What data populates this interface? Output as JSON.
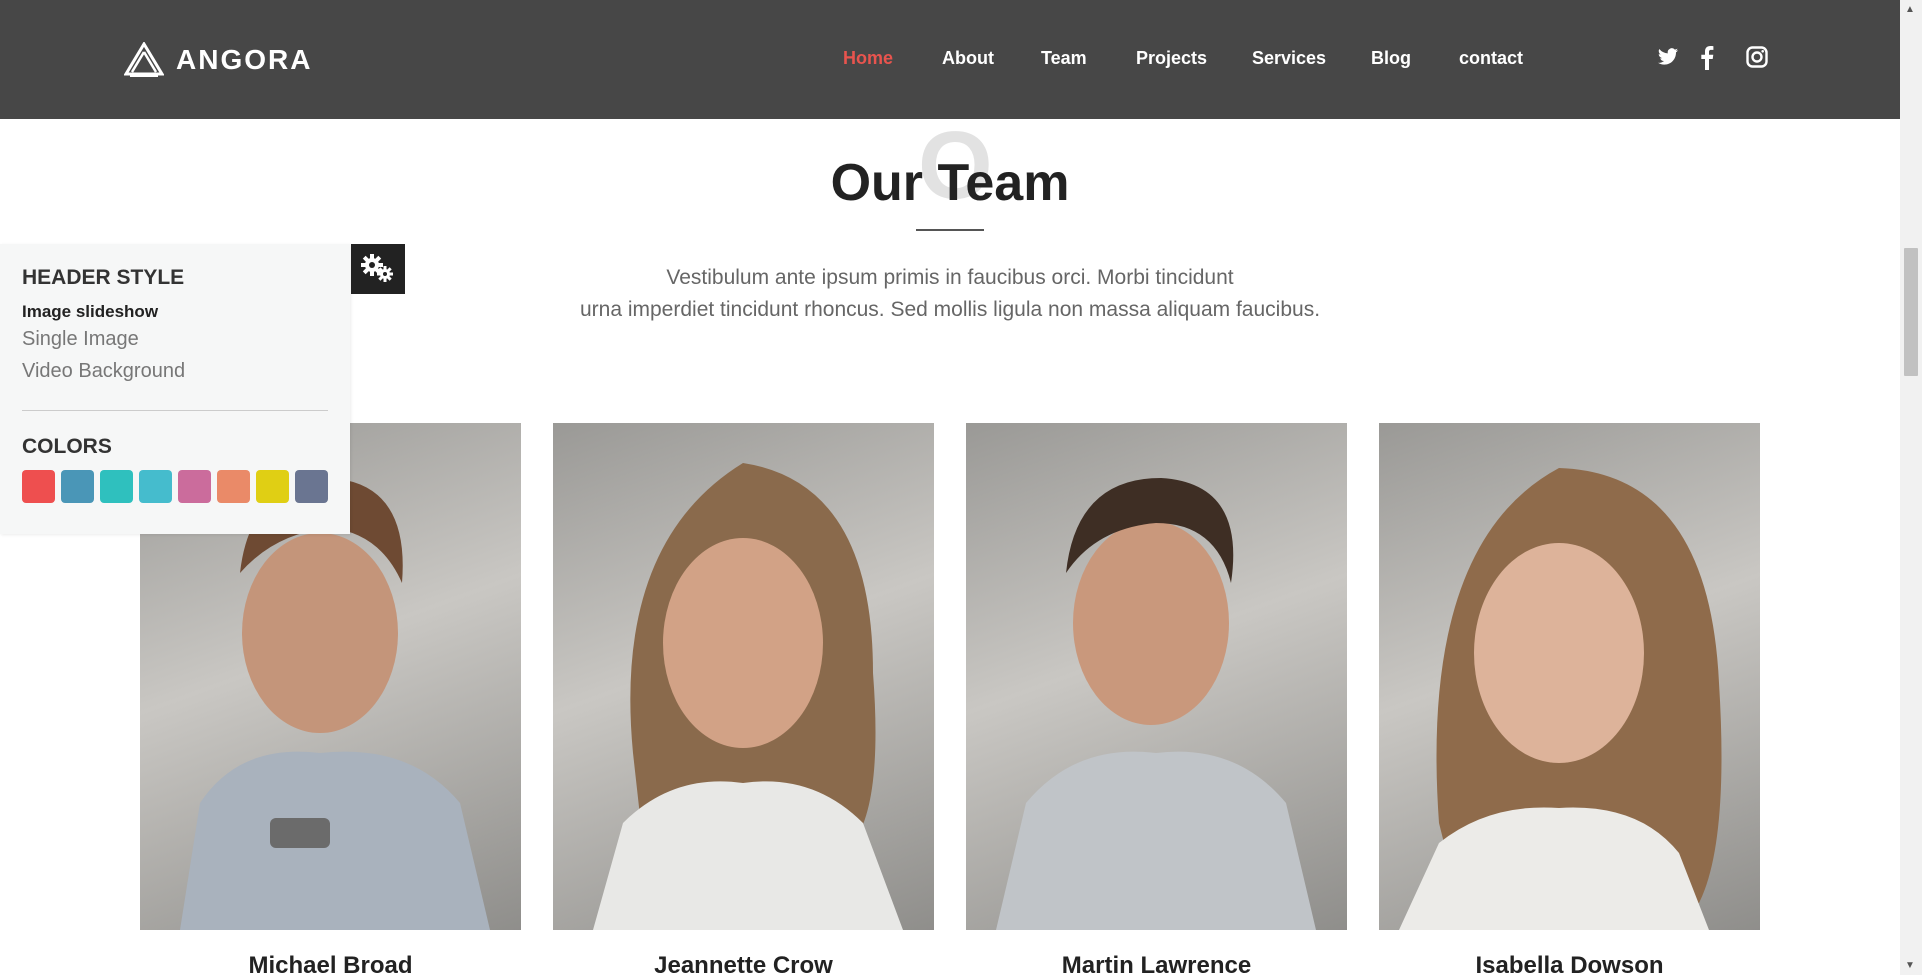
{
  "header": {
    "brand": "ANGORA",
    "nav": [
      {
        "label": "Home",
        "active": true
      },
      {
        "label": "About",
        "active": false
      },
      {
        "label": "Team",
        "active": false
      },
      {
        "label": "Projects",
        "active": false
      },
      {
        "label": "Services",
        "active": false
      },
      {
        "label": "Blog",
        "active": false
      },
      {
        "label": "contact",
        "active": false
      }
    ],
    "social_icons": [
      "twitter-icon",
      "facebook-icon",
      "instagram-icon"
    ],
    "bg_color": "#474747",
    "active_color": "#e8544e"
  },
  "section": {
    "background_letter": "O",
    "title": "Our Team",
    "intro_line1": "Vestibulum ante ipsum primis in faucibus orci. Morbi tincidunt",
    "intro_line2": "urna imperdiet tincidunt rhoncus. Sed mollis ligula non massa aliquam faucibus."
  },
  "team": [
    {
      "name": "Michael Broad"
    },
    {
      "name": "Jeannette Crow"
    },
    {
      "name": "Martin Lawrence"
    },
    {
      "name": "Isabella Dowson"
    }
  ],
  "switcher": {
    "header_style_title": "HEADER STYLE",
    "options": [
      {
        "label": "Image slideshow",
        "active": true
      },
      {
        "label": "Single Image",
        "active": false
      },
      {
        "label": "Video Background",
        "active": false
      }
    ],
    "colors_title": "COLORS",
    "colors": [
      "#ee4f4f",
      "#4a96b7",
      "#2fc0be",
      "#45bccd",
      "#cb6c9c",
      "#ea8a68",
      "#e0cf14",
      "#6a7591"
    ],
    "gear_icon": "gears-icon"
  }
}
